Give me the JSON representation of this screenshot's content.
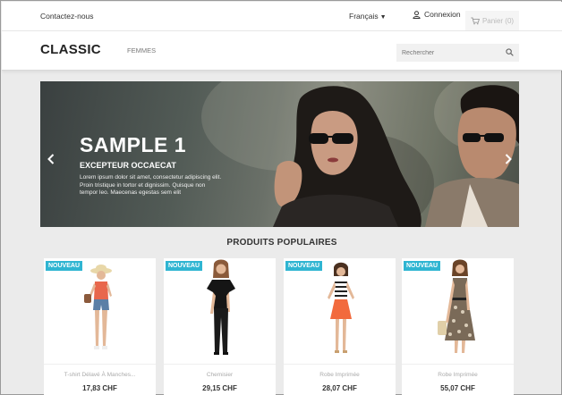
{
  "topbar": {
    "contact": "Contactez-nous",
    "language": "Français",
    "login": "Connexion",
    "cart": "Panier (0)"
  },
  "header": {
    "logo": "CLASSIC",
    "nav_femmes": "FEMMES",
    "search_placeholder": "Rechercher"
  },
  "banner": {
    "title": "SAMPLE 1",
    "subtitle": "EXCEPTEUR OCCAECAT",
    "text": "Lorem ipsum dolor sit amet, consectetur adipiscing elit. Proin tristique in tortor et dignissim. Quisque non tempor leo. Maecenas egestas sem elit"
  },
  "section_title": "PRODUITS POPULAIRES",
  "products": [
    {
      "badge": "NOUVEAU",
      "name": "T-shirt Délavé À Manches...",
      "price": "17,83 CHF"
    },
    {
      "badge": "NOUVEAU",
      "name": "Chemisier",
      "price": "29,15 CHF"
    },
    {
      "badge": "NOUVEAU",
      "name": "Robe Imprimée",
      "price": "28,07 CHF"
    },
    {
      "badge": "NOUVEAU",
      "name": "Robe Imprimée",
      "price": "55,07 CHF"
    }
  ],
  "colors": {
    "accent": "#2fb5d2",
    "text_dark": "#232323",
    "background": "#ebebeb"
  },
  "icons": {
    "login": "user-icon",
    "cart": "cart-icon",
    "search": "search-icon",
    "prev": "chevron-left-icon",
    "next": "chevron-right-icon",
    "language": "caret-down-icon"
  }
}
